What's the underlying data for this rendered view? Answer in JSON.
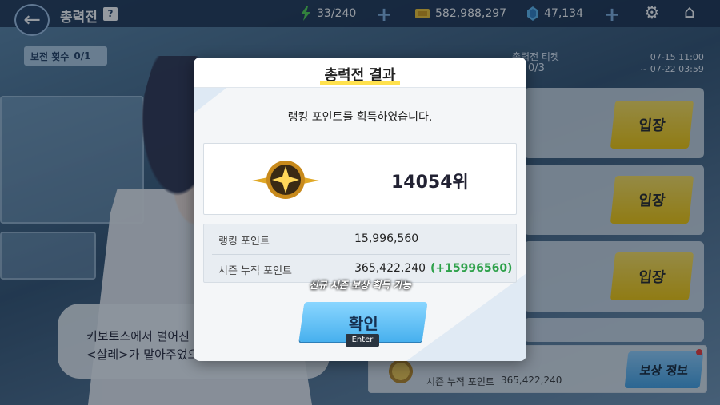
{
  "topbar": {
    "title": "총력전",
    "help": "?",
    "stamina": "33/240",
    "credits": "582,988,297",
    "gems": "47,134"
  },
  "left": {
    "defense_label": "보전 횟수",
    "defense_count": "0/1",
    "speech": "키보토스에서 벌어진\n<살레>가 맡아주었으면 합니다."
  },
  "right": {
    "ticket_label": "총력전 티켓",
    "ticket_count": "0/3",
    "date_start": "07-15 11:00",
    "date_end": "~ 07-22 03:59",
    "entry_label": "입장",
    "season_points_label": "시즌 누적 포인트",
    "season_points": "365,422,240",
    "reward_button": "보상 정보"
  },
  "modal": {
    "title": "총력전 결과",
    "message": "랭킹 포인트를 획득하였습니다.",
    "rank": "14054위",
    "ranking_points_label": "랭킹 포인트",
    "ranking_points": "15,996,560",
    "season_points_label": "시즌 누적 포인트",
    "season_points": "365,422,240",
    "season_points_delta": "(+15996560)",
    "notice": "신규 시즌 보상 획득 가능",
    "confirm": "확인",
    "confirm_key": "Enter"
  },
  "colors": {
    "accent_yellow": "#ffe14d",
    "confirm_blue": "#47b0ee",
    "delta_green": "#2ea14a"
  }
}
